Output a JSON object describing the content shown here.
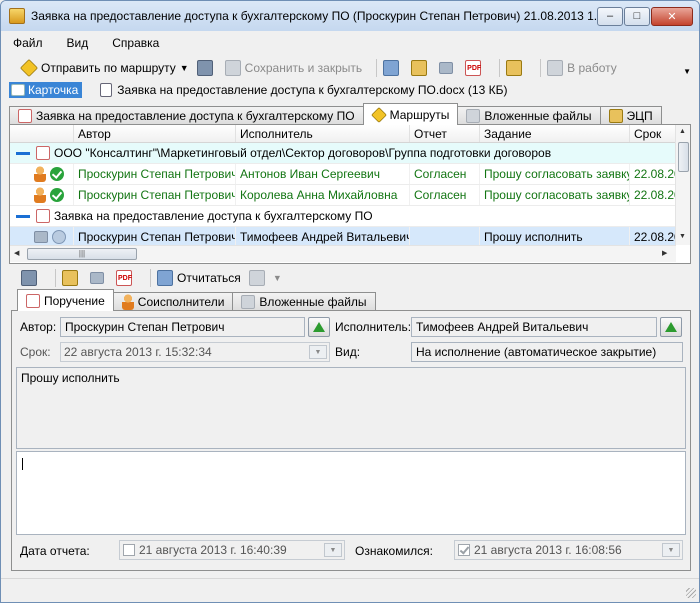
{
  "window": {
    "title": "Заявка на предоставление доступа к бухгалтерскому ПО (Проскурин Степан Петрович) 21.08.2013 1...",
    "controls": {
      "minimize": "–",
      "maximize": "□",
      "close": "✕"
    }
  },
  "menu": [
    "Файл",
    "Вид",
    "Справка"
  ],
  "toolbar": {
    "send_route": "Отправить по маршруту",
    "save_close": "Сохранить и закрыть",
    "in_work": "В работу"
  },
  "card": {
    "card_label": "Карточка",
    "file_label": "Заявка на предоставление доступа к бухгалтерскому ПО.docx (13 КБ)"
  },
  "main_tabs": [
    {
      "label": "Заявка на предоставление доступа к бухгалтерскому ПО",
      "active": false
    },
    {
      "label": "Маршруты",
      "active": true
    },
    {
      "label": "Вложенные файлы",
      "active": false
    },
    {
      "label": "ЭЦП",
      "active": false
    }
  ],
  "grid": {
    "columns": [
      "Автор",
      "Исполнитель",
      "Отчет",
      "Задание",
      "Срок"
    ],
    "group1": "ООО \"Консалтинг\"\\Маркетинговый отдел\\Сектор договоров\\Группа подготовки договоров",
    "rows1": [
      {
        "author": "Проскурин Степан Петрович",
        "executor": "Антонов Иван Сергеевич",
        "report": "Согласен",
        "task": "Прошу согласовать заявку",
        "due": "22.08.20"
      },
      {
        "author": "Проскурин Степан Петрович",
        "executor": "Королева Анна Михайловна",
        "report": "Согласен",
        "task": "Прошу согласовать заявку",
        "due": "22.08.20"
      }
    ],
    "group2": "Заявка на предоставление доступа к бухгалтерскому ПО",
    "rows2": [
      {
        "author": "Проскурин Степан Петрович",
        "executor": "Тимофеев Андрей Витальевич",
        "report": "",
        "task": "Прошу исполнить",
        "due": "22.08.20"
      }
    ]
  },
  "toolbar2": {
    "report_label": "Отчитаться"
  },
  "sub_tabs": [
    {
      "label": "Поручение",
      "active": true
    },
    {
      "label": "Соисполнители",
      "active": false
    },
    {
      "label": "Вложенные файлы",
      "active": false
    }
  ],
  "assignment": {
    "author_label": "Автор:",
    "author_value": "Проскурин Степан Петрович",
    "executor_label": "Исполнитель:",
    "executor_value": "Тимофеев Андрей Витальевич",
    "deadline_label": "Срок:",
    "deadline_value": "22  августа  2013 г. 15:32:34",
    "type_label": "Вид:",
    "type_value": "На исполнение (автоматическое закрытие)",
    "task_text": "Прошу исполнить",
    "report_text": "",
    "report_date_label": "Дата отчета:",
    "report_date_value": "21  августа  2013 г. 16:40:39",
    "acquainted_label": "Ознакомился:",
    "acquainted_value": "21  августа  2013 г. 16:08:56"
  }
}
